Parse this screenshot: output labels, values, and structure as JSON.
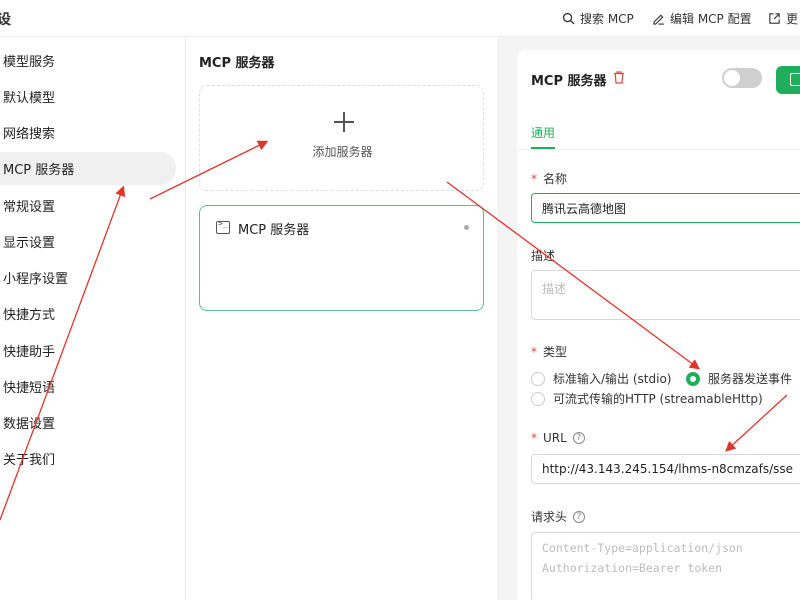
{
  "topbar": {
    "title": "设",
    "search_label": "搜索 MCP",
    "edit_label": "编辑 MCP 配置",
    "more_label": "更"
  },
  "sidebar": {
    "items": [
      {
        "label": "模型服务"
      },
      {
        "label": "默认模型"
      },
      {
        "label": "网络搜索"
      },
      {
        "label": "MCP 服务器",
        "active": true
      },
      {
        "label": "常规设置"
      },
      {
        "label": "显示设置"
      },
      {
        "label": "小程序设置"
      },
      {
        "label": "快捷方式"
      },
      {
        "label": "快捷助手"
      },
      {
        "label": "快捷短语"
      },
      {
        "label": "数据设置"
      },
      {
        "label": "关于我们"
      }
    ]
  },
  "middle": {
    "title": "MCP 服务器",
    "add_label": "添加服务器",
    "server_card": {
      "title": "MCP 服务器"
    }
  },
  "panel": {
    "title": "MCP 服务器",
    "toggle_on": false,
    "tab_general": "通用",
    "name_label": "名称",
    "name_value": "腾讯云高德地图",
    "desc_label": "描述",
    "desc_placeholder": "描述",
    "type_label": "类型",
    "type_options": [
      {
        "label": "标准输入/输出 (stdio)",
        "selected": false
      },
      {
        "label": "服务器发送事件",
        "selected": true
      },
      {
        "label": "可流式传输的HTTP (streamableHttp)",
        "selected": false
      }
    ],
    "url_label": "URL",
    "url_value": "http://43.143.245.154/lhms-n8cmzafs/sse",
    "headers_label": "请求头",
    "headers_placeholder_line1": "Content-Type=application/json",
    "headers_placeholder_line2": "Authorization=Bearer token"
  },
  "colors": {
    "accent": "#1fae5c",
    "annotation": "#e0352b",
    "required": "#e0463a"
  }
}
